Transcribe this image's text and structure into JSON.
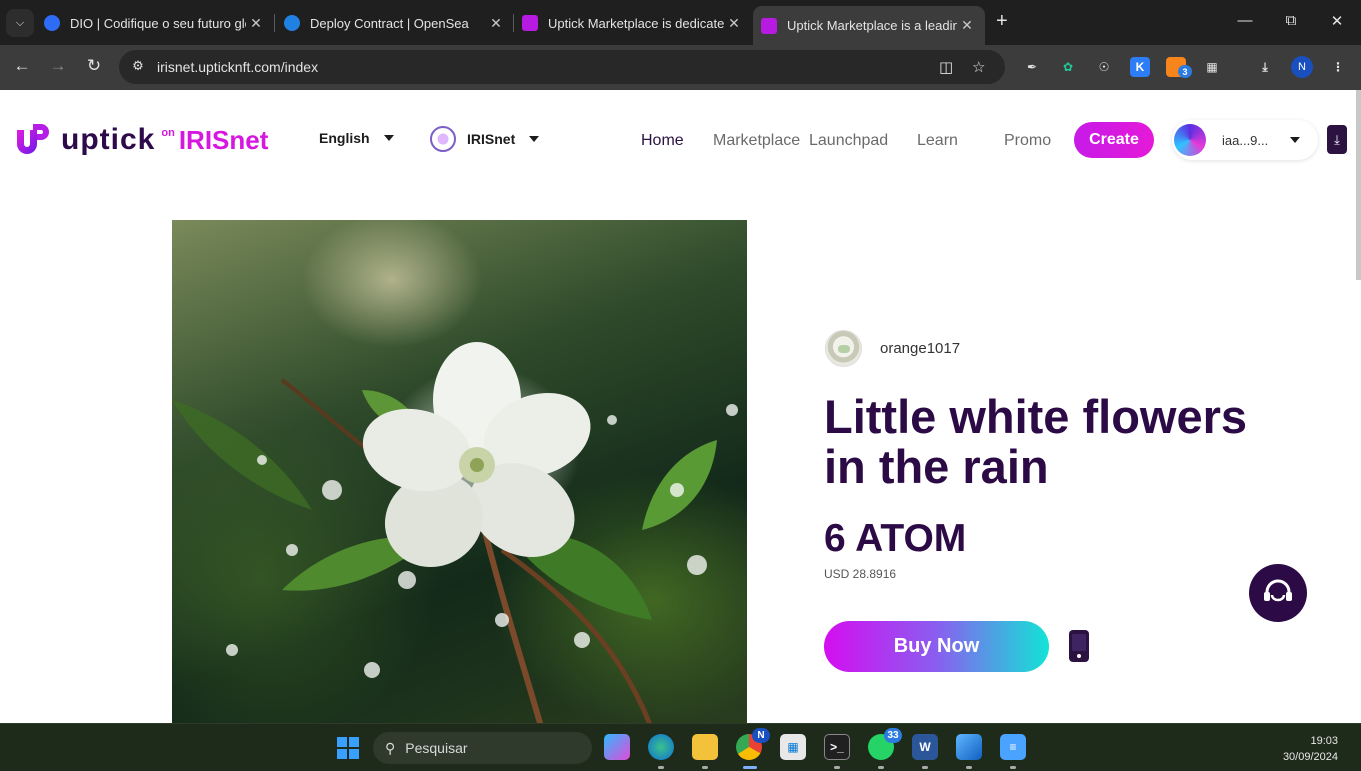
{
  "browser": {
    "tabs": [
      {
        "title": "DIO | Codifique o seu futuro global",
        "favicon_color": "#2f6cf6"
      },
      {
        "title": "Deploy Contract | OpenSea",
        "favicon_color": "#2081e2"
      },
      {
        "title": "Uptick Marketplace is dedicated",
        "favicon_color": "#b71ae0"
      },
      {
        "title": "Uptick Marketplace is a leading",
        "favicon_color": "#b71ae0"
      }
    ],
    "url": "irisnet.uptick nft.com/index",
    "url_display": "irisnet.upticknft.com/index",
    "profile_initial": "N",
    "extension_badge": "3"
  },
  "site": {
    "logo_word": "uptick",
    "logo_on": "on",
    "logo_chain": "IRISnet",
    "language": "English",
    "chain": "IRISnet",
    "menu": [
      "Home",
      "Marketplace",
      "Launchpad",
      "Learn",
      "Promo"
    ],
    "create_label": "Create",
    "wallet_address": "iaa...9..."
  },
  "nft": {
    "creator": "orange1017",
    "title": "Little white flowers in the rain",
    "price": "6 ATOM",
    "usd": "USD 28.8916",
    "buy_label": "Buy Now"
  },
  "taskbar": {
    "search_placeholder": "Pesquisar",
    "whatsapp_badge": "33",
    "chrome_badge": "N",
    "time": "19:03",
    "date": "30/09/2024"
  },
  "colors": {
    "brand_purple": "#2b0a45",
    "brand_magenta": "#d617e0",
    "buy_gradient_start": "#d40ef0",
    "buy_gradient_end": "#12e4d6"
  }
}
